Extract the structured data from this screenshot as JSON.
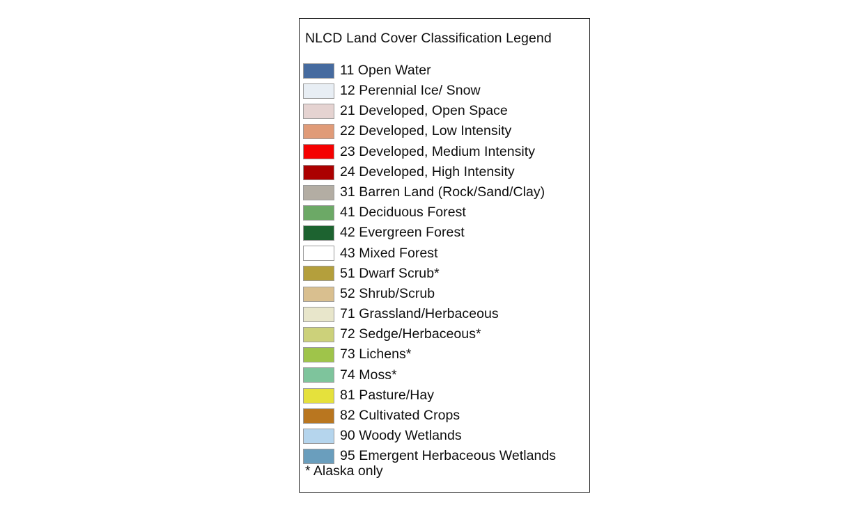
{
  "legend": {
    "title": "NLCD Land Cover Classification Legend",
    "footnote": "* Alaska only",
    "frame_color": "#1a1a1a",
    "swatch_border_color": "#9a9a9a",
    "text_color": "#0d0d0d",
    "items": [
      {
        "code": "11",
        "name": "Open Water",
        "label": "11 Open Water",
        "color": "#466b9f"
      },
      {
        "code": "12",
        "name": "Perennial Ice/ Snow",
        "label": "12 Perennial Ice/ Snow",
        "color": "#e8eef4"
      },
      {
        "code": "21",
        "name": "Developed, Open Space",
        "label": "21 Developed, Open Space",
        "color": "#e5d3d1"
      },
      {
        "code": "22",
        "name": "Developed, Low Intensity",
        "label": "22 Developed, Low Intensity",
        "color": "#e09b78"
      },
      {
        "code": "23",
        "name": "Developed, Medium Intensity",
        "label": "23 Developed, Medium Intensity",
        "color": "#f50000"
      },
      {
        "code": "24",
        "name": "Developed, High Intensity",
        "label": "24 Developed, High Intensity",
        "color": "#ab0000"
      },
      {
        "code": "31",
        "name": "Barren Land (Rock/Sand/Clay)",
        "label": "31 Barren Land (Rock/Sand/Clay)",
        "color": "#b3ada3"
      },
      {
        "code": "41",
        "name": "Deciduous Forest",
        "label": "41 Deciduous Forest",
        "color": "#6ca966"
      },
      {
        "code": "42",
        "name": "Evergreen Forest",
        "label": "42 Evergreen Forest",
        "color": "#1d6330"
      },
      {
        "code": "43",
        "name": "Mixed Forest",
        "label": "43 Mixed Forest",
        "color": "#bcd описание"
      },
      {
        "code": "51",
        "name": "Dwarf Scrub*",
        "label": "51 Dwarf Scrub*",
        "color": "#b49f3c"
      },
      {
        "code": "52",
        "name": "Shrub/Scrub",
        "label": "52 Shrub/Scrub",
        "color": "#d9bf8f"
      },
      {
        "code": "71",
        "name": "Grassland/Herbaceous",
        "label": "71 Grassland/Herbaceous",
        "color": "#e8e6cb"
      },
      {
        "code": "72",
        "name": "Sedge/Herbaceous*",
        "label": "72 Sedge/Herbaceous*",
        "color": "#ccd17a"
      },
      {
        "code": "73",
        "name": "Lichens*",
        "label": "73 Lichens*",
        "color": "#9fc44a"
      },
      {
        "code": "74",
        "name": "Moss*",
        "label": "74 Moss*",
        "color": "#7ec49c"
      },
      {
        "code": "81",
        "name": "Pasture/Hay",
        "label": "81 Pasture/Hay",
        "color": "#e5e13c"
      },
      {
        "code": "82",
        "name": "Cultivated Crops",
        "label": "82 Cultivated Crops",
        "color": "#b9761f"
      },
      {
        "code": "90",
        "name": "Woody Wetlands",
        "label": "90 Woody Wetlands",
        "color": "#b5d5ed"
      },
      {
        "code": "95",
        "name": "Emergent Herbaceous Wetlands",
        "label": "95 Emergent Herbaceous Wetlands",
        "color": "#6a9ebd"
      }
    ]
  }
}
